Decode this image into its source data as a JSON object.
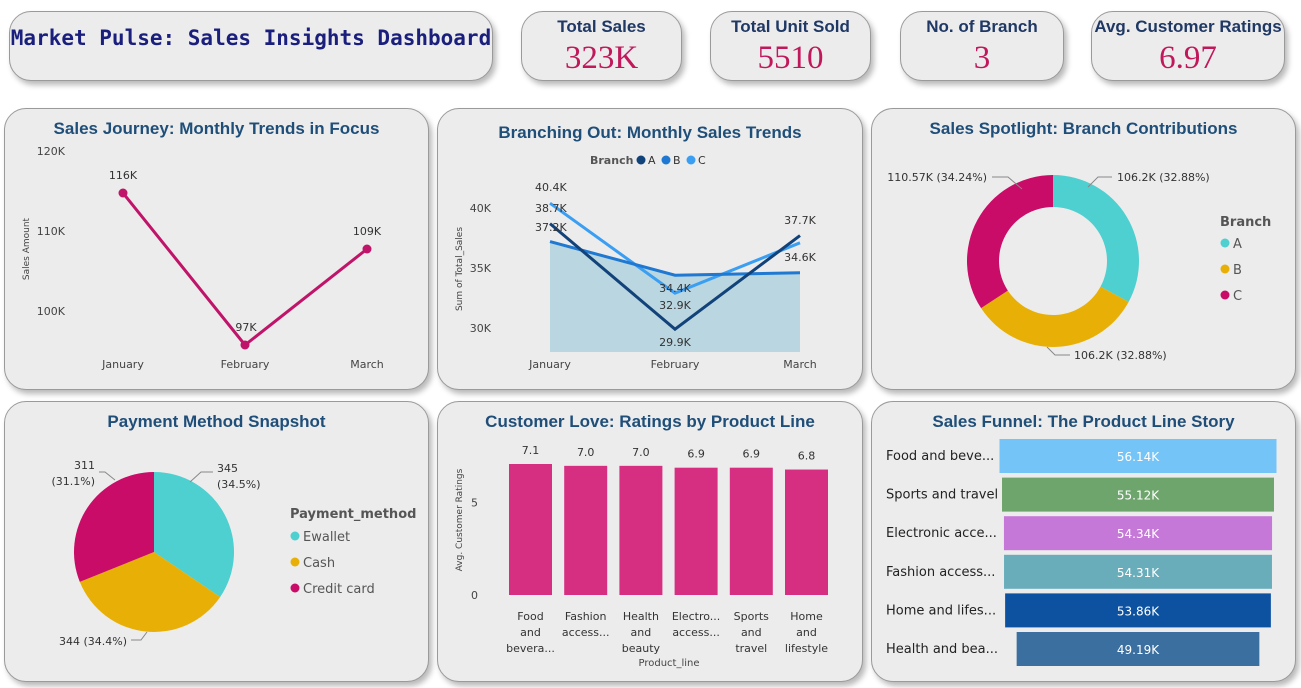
{
  "header": {
    "title": "Market Pulse: Sales Insights Dashboard"
  },
  "kpis": [
    {
      "label": "Total Sales",
      "value": "323K"
    },
    {
      "label": "Total Unit Sold",
      "value": "5510"
    },
    {
      "label": "No. of Branch",
      "value": "3"
    },
    {
      "label": "Avg. Customer Ratings",
      "value": "6.97"
    }
  ],
  "colors": {
    "accent": "#c0185a",
    "title": "#1f4e79"
  },
  "chart_data": [
    {
      "type": "line",
      "title": "Sales Journey: Monthly Trends in Focus",
      "ylabel": "Sales Amount",
      "categories": [
        "January",
        "February",
        "March"
      ],
      "values": [
        116,
        97,
        109
      ],
      "data_labels": [
        "116K",
        "97K",
        "109K"
      ],
      "ylim": [
        95,
        122
      ],
      "yticks": [
        "100K",
        "110K",
        "120K"
      ],
      "color": "#c0146a"
    },
    {
      "type": "line",
      "title": "Branching Out: Monthly Sales Trends",
      "ylabel": "Sum of Total_Sales",
      "legend_title": "Branch",
      "categories": [
        "January",
        "February",
        "March"
      ],
      "yticks": [
        "30K",
        "35K",
        "40K"
      ],
      "ylim": [
        28,
        43
      ],
      "series": [
        {
          "name": "A",
          "values": [
            38.7,
            29.9,
            37.7
          ],
          "labels": [
            "38.7K",
            "29.9K",
            "37.7K"
          ],
          "color": "#12427a"
        },
        {
          "name": "B",
          "values": [
            37.2,
            34.4,
            34.6
          ],
          "labels": [
            "37.2K",
            "34.4K",
            "34.6K"
          ],
          "color": "#1f78d1"
        },
        {
          "name": "C",
          "values": [
            40.4,
            32.9,
            37.1
          ],
          "labels": [
            "40.4K",
            "32.9K",
            ""
          ],
          "color": "#3a9ef2"
        }
      ]
    },
    {
      "type": "pie",
      "donut": true,
      "title": "Sales Spotlight: Branch Contributions",
      "legend_title": "Branch",
      "slices": [
        {
          "name": "A",
          "value": 106.2,
          "label": "106.2K (32.88%)",
          "color": "#4ecfd0"
        },
        {
          "name": "B",
          "value": 106.2,
          "label": "106.2K (32.88%)",
          "color": "#e8b007"
        },
        {
          "name": "C",
          "value": 110.57,
          "label": "110.57K (34.24%)",
          "color": "#c80c68"
        }
      ]
    },
    {
      "type": "pie",
      "title": "Payment Method Snapshot",
      "legend_title": "Payment_method",
      "slices": [
        {
          "name": "Ewallet",
          "value": 345,
          "label_top": "345",
          "label_bottom": "(34.5%)",
          "color": "#4ecfd0"
        },
        {
          "name": "Cash",
          "value": 344,
          "label_top": "344 (34.4%)",
          "label_bottom": "",
          "color": "#e8b007"
        },
        {
          "name": "Credit card",
          "value": 311,
          "label_top": "311",
          "label_bottom": "(31.1%)",
          "color": "#c80c68"
        }
      ]
    },
    {
      "type": "bar",
      "title": "Customer Love: Ratings by Product Line",
      "xlabel": "Product_line",
      "ylabel": "Avg. Customer Ratings",
      "categories": [
        [
          "Food",
          "and",
          "bevera..."
        ],
        [
          "Fashion",
          "access..."
        ],
        [
          "Health",
          "and",
          "beauty"
        ],
        [
          "Electro...",
          "access..."
        ],
        [
          "Sports",
          "and",
          "travel"
        ],
        [
          "Home",
          "and",
          "lifestyle"
        ]
      ],
      "values": [
        7.1,
        7.0,
        7.0,
        6.9,
        6.9,
        6.8
      ],
      "data_labels": [
        "7.1",
        "7.0",
        "7.0",
        "6.9",
        "6.9",
        "6.8"
      ],
      "yticks": [
        "0",
        "5"
      ],
      "ylim": [
        0,
        7.6
      ],
      "color": "#d62f82"
    },
    {
      "type": "bar",
      "title": "Sales Funnel: The Product Line Story",
      "orientation": "funnel",
      "categories": [
        "Food and beve...",
        "Sports and travel",
        "Electronic acce...",
        "Fashion access...",
        "Home and lifes...",
        "Health and bea..."
      ],
      "values": [
        56.14,
        55.12,
        54.34,
        54.31,
        53.86,
        49.19
      ],
      "data_labels": [
        "56.14K",
        "55.12K",
        "54.34K",
        "54.31K",
        "53.86K",
        "49.19K"
      ],
      "colors": [
        "#75c4f7",
        "#6ea56c",
        "#c678d8",
        "#69adbb",
        "#0c52a0",
        "#3a6fa0"
      ]
    }
  ]
}
